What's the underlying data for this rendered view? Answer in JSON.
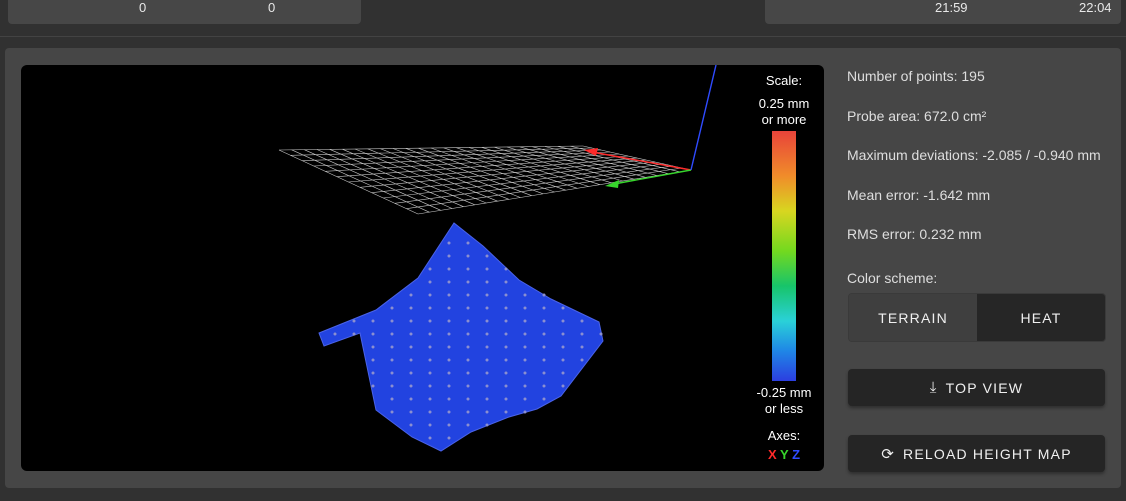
{
  "top_left_card": {
    "value_a": "0",
    "value_b": "0"
  },
  "top_right_card": {
    "time_a": "21:59",
    "time_b": "22:04"
  },
  "legend": {
    "scale_title": "Scale:",
    "max_line1": "0.25 mm",
    "max_line2": "or more",
    "min_line1": "-0.25 mm",
    "min_line2": "or less",
    "axes_title": "Axes:",
    "axis_x": "X",
    "axis_y": "Y",
    "axis_z": "Z",
    "colors": {
      "x": "#ff2a2a",
      "y": "#37d52c",
      "z": "#2f4bff"
    }
  },
  "stats": {
    "points": "Number of points: 195",
    "probe_area": "Probe area: 672.0 cm²",
    "max_dev": "Maximum deviations: -2.085 / -0.940 mm",
    "mean_error": "Mean error: -1.642 mm",
    "rms_error": "RMS error: 0.232 mm"
  },
  "color_scheme": {
    "label": "Color scheme:",
    "options": [
      "TERRAIN",
      "HEAT"
    ],
    "selected": "TERRAIN"
  },
  "buttons": {
    "top_view": "TOP VIEW",
    "top_view_icon": "download-icon",
    "reload": "RELOAD HEIGHT MAP",
    "reload_icon": "reload-icon"
  },
  "mesh_color": "#2243e0"
}
